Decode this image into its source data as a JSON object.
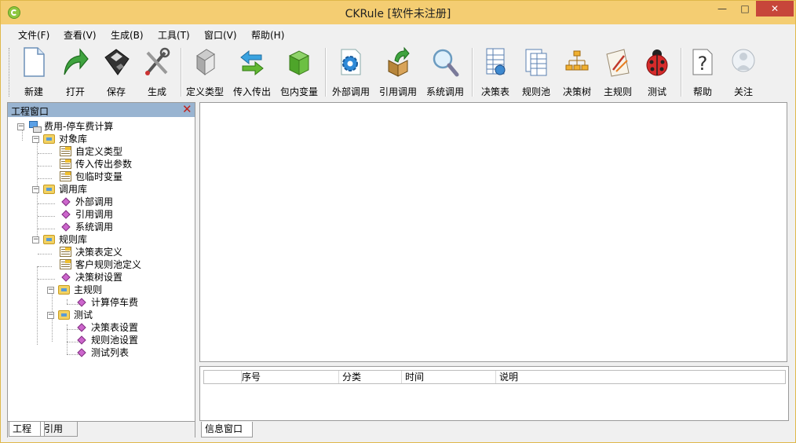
{
  "window": {
    "title": "CKRule [软件未注册]",
    "min": "—",
    "max": "□",
    "close": "✕"
  },
  "menu": [
    "文件(F)",
    "查看(V)",
    "生成(B)",
    "工具(T)",
    "窗口(V)",
    "帮助(H)"
  ],
  "toolbar": [
    {
      "label": "新建",
      "icon": "new-file-icon"
    },
    {
      "label": "打开",
      "icon": "open-arrow-icon"
    },
    {
      "label": "保存",
      "icon": "floppy-disk-icon"
    },
    {
      "label": "生成",
      "icon": "tools-icon"
    },
    {
      "label": "定义类型",
      "icon": "define-type-icon"
    },
    {
      "label": "传入传出",
      "icon": "in-out-arrows-icon"
    },
    {
      "label": "包内变量",
      "icon": "package-box-icon"
    },
    {
      "label": "外部调用",
      "icon": "gear-icon"
    },
    {
      "label": "引用调用",
      "icon": "box-arrow-icon"
    },
    {
      "label": "系统调用",
      "icon": "magnifier-icon"
    },
    {
      "label": "决策表",
      "icon": "decision-table-icon"
    },
    {
      "label": "规则池",
      "icon": "rule-pool-icon"
    },
    {
      "label": "决策树",
      "icon": "decision-tree-icon"
    },
    {
      "label": "主规则",
      "icon": "main-rule-icon"
    },
    {
      "label": "测试",
      "icon": "ladybug-icon"
    },
    {
      "label": "帮助",
      "icon": "help-icon"
    },
    {
      "label": "关注",
      "icon": "follow-icon"
    }
  ],
  "project": {
    "title": "工程窗口",
    "tree": {
      "root": "费用-停车费计算",
      "object_lib": "对象库",
      "custom_type": "自定义类型",
      "io_params": "传入传出参数",
      "pkg_vars": "包临时变量",
      "call_lib": "调用库",
      "external_call": "外部调用",
      "ref_call": "引用调用",
      "system_call": "系统调用",
      "rule_lib": "规则库",
      "decision_table_def": "决策表定义",
      "client_pool_def": "客户规则池定义",
      "decision_tree_set": "决策树设置",
      "main_rule": "主规则",
      "calc_fee": "计算停车费",
      "test": "测试",
      "dt_setting": "决策表设置",
      "pool_setting": "规则池设置",
      "test_list": "测试列表"
    },
    "tabs": {
      "project": "工程",
      "reference": "引用"
    }
  },
  "info": {
    "columns": {
      "seq": "序号",
      "category": "分类",
      "time": "时间",
      "desc": "说明"
    },
    "tab": "信息窗口"
  }
}
